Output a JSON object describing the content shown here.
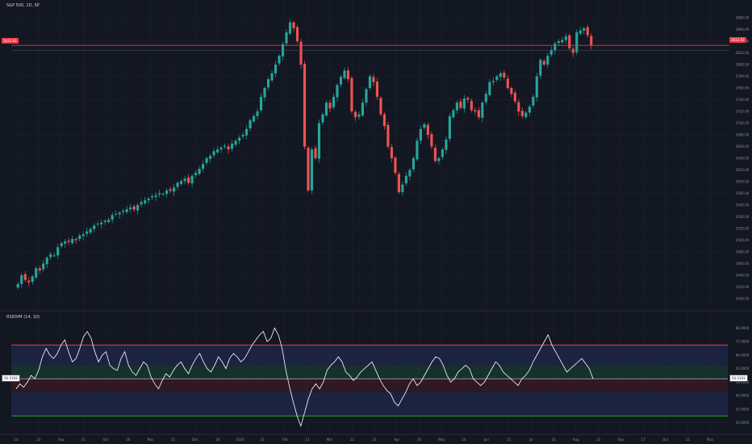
{
  "header": {
    "title": "S&P 500, 1D, SP",
    "osc_title": "RSIDVM (14, 10)"
  },
  "price_axis": {
    "labels": [
      "2880.00",
      "2860.00",
      "2840.00",
      "2820.00",
      "2800.00",
      "2780.00",
      "2760.00",
      "2740.00",
      "2720.00",
      "2700.00",
      "2680.00",
      "2660.00",
      "2640.00",
      "2620.00",
      "2600.00",
      "2580.00",
      "2560.00",
      "2540.00",
      "2520.00",
      "2500.00",
      "2480.00",
      "2460.00",
      "2440.00",
      "2420.00",
      "2400.00"
    ],
    "last_price": "2832.83",
    "last_price_left": "2832.83"
  },
  "osc_axis": {
    "labels": [
      "80.0000",
      "72.0000",
      "64.0000",
      "56.0000",
      "48.0000",
      "40.0000",
      "32.0000",
      "24.0000"
    ],
    "last_value": "50.5193",
    "last_value_left": "50.5193"
  },
  "time_axis": {
    "labels": [
      "14",
      "23",
      "Sep",
      "11",
      "Oct",
      "16",
      "Nov",
      "15",
      "Dec",
      "18",
      "2018",
      "22",
      "Feb",
      "13",
      "Mar",
      "12",
      "21",
      "Apr",
      "10",
      "May",
      "14",
      "Jun",
      "15",
      "Jul",
      "16",
      "Aug",
      "13",
      "Sep",
      "17",
      "Oct",
      "15",
      "Nov"
    ]
  },
  "colors": {
    "background": "#131722",
    "up": "#26a69a",
    "down": "#ef5350",
    "grid": "#1e2230",
    "osc_line": "#ffffff",
    "upper_band": "#f23645",
    "lower_band": "#22ab2f"
  },
  "chart_data": [
    {
      "type": "candlestick",
      "title": "S&P 500, 1D, SP",
      "ylim": [
        2400,
        2880
      ],
      "resistance_level": 2832.83,
      "close_series": [
        2425,
        2440,
        2432,
        2428,
        2438,
        2452,
        2448,
        2460,
        2470,
        2476,
        2474,
        2488,
        2495,
        2498,
        2497,
        2502,
        2500,
        2508,
        2510,
        2515,
        2519,
        2525,
        2528,
        2530,
        2533,
        2535,
        2543,
        2545,
        2547,
        2550,
        2553,
        2556,
        2552,
        2560,
        2565,
        2568,
        2571,
        2575,
        2577,
        2580,
        2579,
        2585,
        2584,
        2590,
        2598,
        2601,
        2605,
        2598,
        2610,
        2615,
        2622,
        2630,
        2640,
        2644,
        2652,
        2655,
        2658,
        2661,
        2655,
        2665,
        2670,
        2675,
        2680,
        2690,
        2705,
        2712,
        2720,
        2745,
        2760,
        2775,
        2785,
        2800,
        2815,
        2835,
        2855,
        2872,
        2862,
        2840,
        2800,
        2660,
        2585,
        2655,
        2640,
        2700,
        2715,
        2735,
        2725,
        2745,
        2765,
        2779,
        2790,
        2775,
        2720,
        2710,
        2715,
        2735,
        2758,
        2780,
        2770,
        2745,
        2715,
        2695,
        2660,
        2640,
        2615,
        2582,
        2595,
        2610,
        2620,
        2640,
        2670,
        2690,
        2698,
        2680,
        2660,
        2635,
        2640,
        2655,
        2672,
        2712,
        2722,
        2735,
        2726,
        2742,
        2740,
        2722,
        2720,
        2710,
        2735,
        2750,
        2770,
        2772,
        2780,
        2785,
        2778,
        2760,
        2750,
        2737,
        2720,
        2712,
        2718,
        2728,
        2745,
        2780,
        2808,
        2800,
        2815,
        2825,
        2836,
        2840,
        2842,
        2848,
        2828,
        2820,
        2855,
        2858,
        2862,
        2850,
        2833
      ]
    },
    {
      "type": "line",
      "title": "RSIDVM (14, 10)",
      "ylim": [
        20,
        84
      ],
      "upper_band": 70,
      "mid_band": 50,
      "lower_band": 28,
      "values": [
        44,
        47,
        45,
        48,
        52,
        50,
        55,
        63,
        68,
        64,
        62,
        65,
        70,
        73,
        66,
        60,
        62,
        68,
        75,
        78,
        74,
        66,
        60,
        64,
        66,
        58,
        56,
        55,
        62,
        66,
        58,
        54,
        52,
        56,
        60,
        58,
        51,
        47,
        44,
        49,
        53,
        51,
        55,
        58,
        60,
        56,
        53,
        58,
        62,
        65,
        60,
        56,
        54,
        58,
        63,
        60,
        56,
        62,
        65,
        63,
        60,
        62,
        66,
        70,
        73,
        76,
        78,
        72,
        74,
        80,
        76,
        68,
        55,
        45,
        36,
        28,
        22,
        30,
        38,
        44,
        47,
        44,
        48,
        55,
        58,
        60,
        63,
        60,
        54,
        52,
        49,
        51,
        54,
        56,
        58,
        60,
        55,
        50,
        46,
        43,
        41,
        36,
        34,
        38,
        42,
        47,
        50,
        46,
        48,
        52,
        56,
        60,
        63,
        62,
        58,
        52,
        48,
        50,
        54,
        56,
        58,
        56,
        50,
        48,
        46,
        48,
        52,
        56,
        60,
        58,
        54,
        52,
        50,
        48,
        46,
        50,
        52,
        55,
        60,
        64,
        68,
        72,
        76,
        70,
        66,
        62,
        58,
        54,
        56,
        58,
        60,
        62,
        59,
        56,
        50
      ]
    }
  ]
}
